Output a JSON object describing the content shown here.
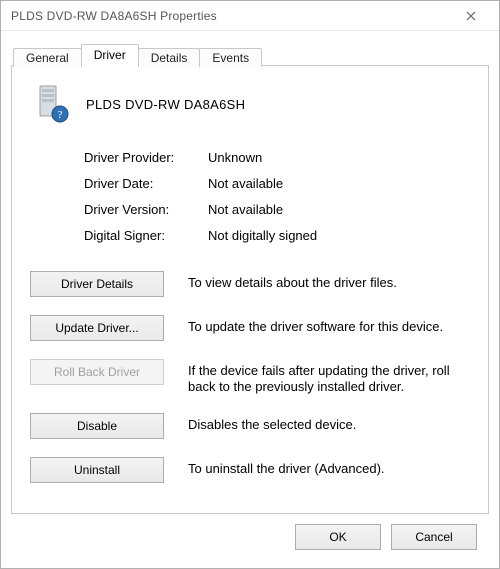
{
  "window": {
    "title": "PLDS    DVD-RW DA8A6SH Properties"
  },
  "tabs": {
    "general": "General",
    "driver": "Driver",
    "details": "Details",
    "events": "Events",
    "active": "driver"
  },
  "device": {
    "name": "PLDS    DVD-RW DA8A6SH"
  },
  "info": {
    "provider_label": "Driver Provider:",
    "provider_value": "Unknown",
    "date_label": "Driver Date:",
    "date_value": "Not available",
    "version_label": "Driver Version:",
    "version_value": "Not available",
    "signer_label": "Digital Signer:",
    "signer_value": "Not digitally signed"
  },
  "actions": {
    "details_btn": "Driver Details",
    "details_desc": "To view details about the driver files.",
    "update_btn": "Update Driver...",
    "update_desc": "To update the driver software for this device.",
    "rollback_btn": "Roll Back Driver",
    "rollback_desc": "If the device fails after updating the driver, roll back to the previously installed driver.",
    "disable_btn": "Disable",
    "disable_desc": "Disables the selected device.",
    "uninstall_btn": "Uninstall",
    "uninstall_desc": "To uninstall the driver (Advanced)."
  },
  "footer": {
    "ok": "OK",
    "cancel": "Cancel"
  },
  "icons": {
    "device": "optical-drive-icon",
    "close": "close-icon"
  }
}
